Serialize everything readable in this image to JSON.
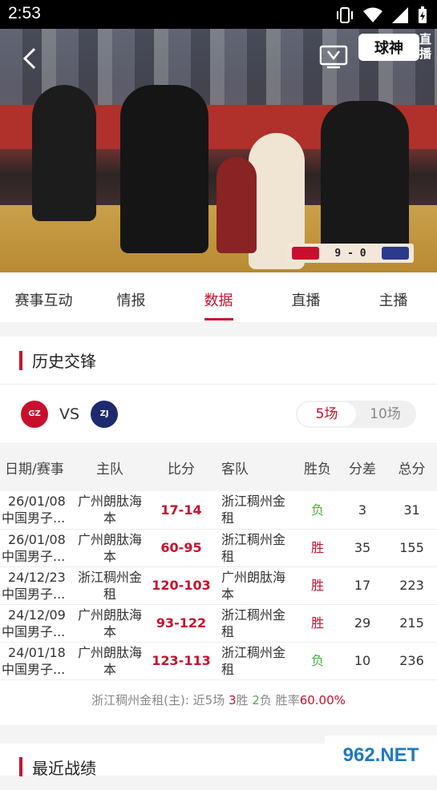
{
  "status_bar": {
    "time": "2:53"
  },
  "video": {
    "broadcaster_logo": "球神",
    "live_tag": "直播",
    "score": "9 - 0"
  },
  "tabs": [
    {
      "label": "赛事互动",
      "active": false
    },
    {
      "label": "情报",
      "active": false
    },
    {
      "label": "数据",
      "active": true
    },
    {
      "label": "直播",
      "active": false
    },
    {
      "label": "主播",
      "active": false
    }
  ],
  "head_to_head": {
    "title": "历史交锋",
    "vs": "VS",
    "filters": [
      "5场",
      "10场"
    ],
    "selected_filter": "5场",
    "columns": [
      "日期/赛事",
      "主队",
      "比分",
      "客队",
      "胜负",
      "分差",
      "总分"
    ],
    "rows": [
      {
        "date": "26/01/08",
        "league": "中国男子...",
        "home": "广州朗肽海本",
        "score": "17-14",
        "away": "浙江稠州金租",
        "result": "负",
        "diff": "3",
        "total": "31"
      },
      {
        "date": "26/01/08",
        "league": "中国男子...",
        "home": "广州朗肽海本",
        "score": "60-95",
        "away": "浙江稠州金租",
        "result": "胜",
        "diff": "35",
        "total": "155"
      },
      {
        "date": "24/12/23",
        "league": "中国男子...",
        "home": "浙江稠州金租",
        "score": "120-103",
        "away": "广州朗肽海本",
        "result": "胜",
        "diff": "17",
        "total": "223"
      },
      {
        "date": "24/12/09",
        "league": "中国男子...",
        "home": "广州朗肽海本",
        "score": "93-122",
        "away": "浙江稠州金租",
        "result": "胜",
        "diff": "29",
        "total": "215"
      },
      {
        "date": "24/01/18",
        "league": "中国男子...",
        "home": "广州朗肽海本",
        "score": "123-113",
        "away": "浙江稠州金租",
        "result": "负",
        "diff": "10",
        "total": "236"
      }
    ],
    "summary": {
      "team": "浙江稠州金租(主):",
      "recent": "近5场",
      "wins": "3",
      "win_label": "胜",
      "losses": "2",
      "loss_label": "负",
      "rate_label": "胜率",
      "rate": "60.00%"
    }
  },
  "recent_form": {
    "title": "最近战绩"
  },
  "watermark": "962.NET",
  "colors": {
    "accent": "#c8102e",
    "win": "#c8102e",
    "lose": "#3db83d"
  }
}
